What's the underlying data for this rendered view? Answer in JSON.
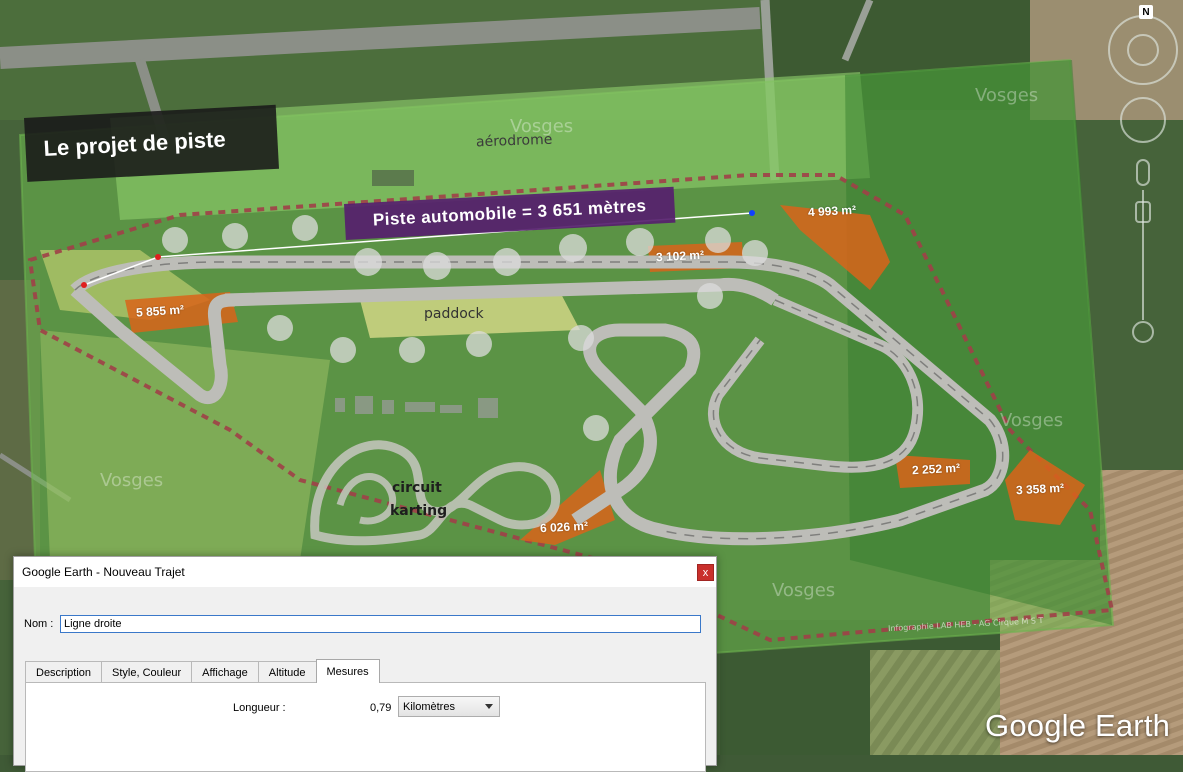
{
  "map": {
    "overlay_title": "Le projet de piste",
    "aerodrome_label": "aérodrome",
    "track_label": "Piste automobile = 3 651 mètres",
    "paddock_label": "paddock",
    "karting_label_line1": "circuit",
    "karting_label_line2": "karting",
    "areas": [
      "5 855 m²",
      "3 102 m²",
      "4 993 m²",
      "2 252 m²",
      "3 358 m²",
      "6 026 m²"
    ],
    "watermarks": [
      "Vosges",
      "Vosges",
      "Vosges",
      "Vosges",
      "Vosges"
    ],
    "credit": "Infographie LAB HEB - AG Cirque M S T",
    "north_label": "N",
    "logo": "Google Earth",
    "colors": {
      "path_line": "#ffffff",
      "path_point": "#e02020",
      "path_end_point": "#1040ff",
      "area_fill": "#d9641a",
      "track_label_bg": "#561e6e"
    }
  },
  "dialog": {
    "title": "Google Earth - Nouveau Trajet",
    "close_label": "x",
    "name_label": "Nom :",
    "name_value": "Ligne droite",
    "tabs": [
      {
        "label": "Description"
      },
      {
        "label": "Style, Couleur"
      },
      {
        "label": "Affichage"
      },
      {
        "label": "Altitude"
      },
      {
        "label": "Mesures"
      }
    ],
    "active_tab": "Mesures",
    "length_label": "Longueur :",
    "length_value": "0,79",
    "unit_value": "Kilomètres"
  }
}
